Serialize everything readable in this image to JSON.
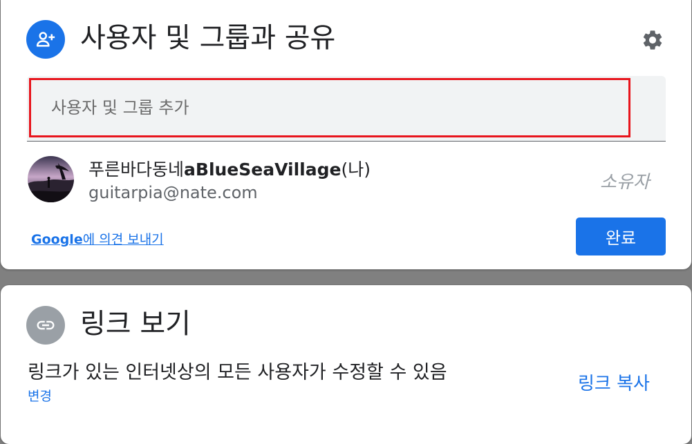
{
  "share_dialog": {
    "title": "사용자 및 그룹과 공유",
    "icon": "person-add-icon",
    "settings_icon": "gear-icon",
    "add_input": {
      "placeholder": "사용자 및 그룹 추가",
      "value": ""
    },
    "owner": {
      "name_prefix": "푸른바다동네",
      "name_bold": "aBlueSeaVillage",
      "name_suffix": "(나)",
      "email": "guitarpia@nate.com",
      "role": "소유자"
    },
    "feedback": {
      "brand": "Google",
      "text": "에 의견 보내기"
    },
    "done_label": "완료"
  },
  "link_dialog": {
    "title": "링크 보기",
    "icon": "link-icon",
    "description": "링크가 있는 인터넷상의 모든 사용자가 수정할 수 있음",
    "change_label": "변경",
    "copy_label": "링크 복사"
  },
  "colors": {
    "primary": "#1a73e8",
    "highlight_border": "#e8141c",
    "link_icon_bg": "#9aa0a6"
  }
}
